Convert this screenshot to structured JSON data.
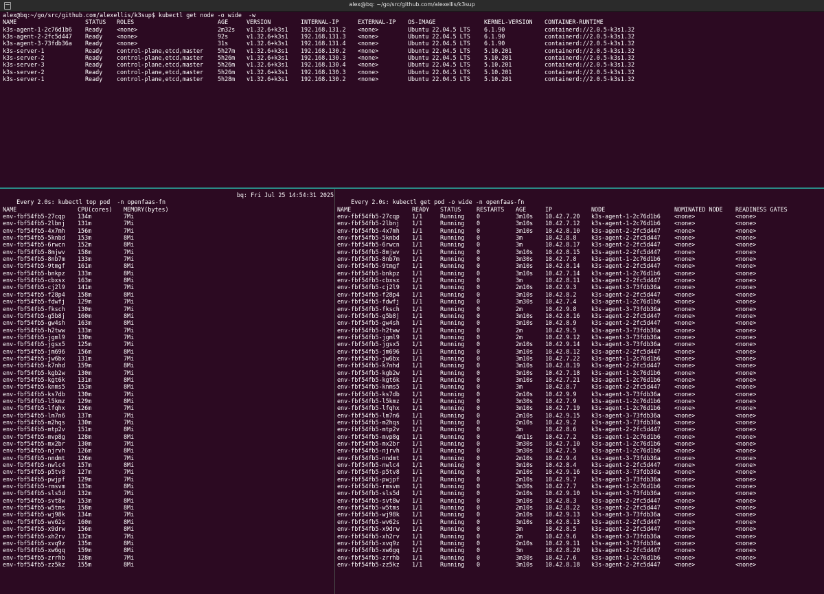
{
  "window": {
    "title": "alex@bq: ~/go/src/github.com/alexellis/k3sup"
  },
  "top_pane": {
    "prompt": "alex@bq:~/go/src/github.com/alexellis/k3sup$ kubectl get node -o wide  -w",
    "headers": [
      "NAME",
      "STATUS",
      "ROLES",
      "AGE",
      "VERSION",
      "INTERNAL-IP",
      "EXTERNAL-IP",
      "OS-IMAGE",
      "KERNEL-VERSION",
      "CONTAINER-RUNTIME"
    ],
    "rows": [
      [
        "k3s-agent-1-2c76d1b6",
        "Ready",
        "<none>",
        "2m32s",
        "v1.32.6+k3s1",
        "192.168.131.2",
        "<none>",
        "Ubuntu 22.04.5 LTS",
        "6.1.90",
        "containerd://2.0.5-k3s1.32"
      ],
      [
        "k3s-agent-2-2fc5d447",
        "Ready",
        "<none>",
        "92s",
        "v1.32.6+k3s1",
        "192.168.131.3",
        "<none>",
        "Ubuntu 22.04.5 LTS",
        "6.1.90",
        "containerd://2.0.5-k3s1.32"
      ],
      [
        "k3s-agent-3-73fdb36a",
        "Ready",
        "<none>",
        "31s",
        "v1.32.6+k3s1",
        "192.168.131.4",
        "<none>",
        "Ubuntu 22.04.5 LTS",
        "6.1.90",
        "containerd://2.0.5-k3s1.32"
      ],
      [
        "k3s-server-1",
        "Ready",
        "control-plane,etcd,master",
        "5h27m",
        "v1.32.6+k3s1",
        "192.168.130.2",
        "<none>",
        "Ubuntu 22.04.5 LTS",
        "5.10.201",
        "containerd://2.0.5-k3s1.32"
      ],
      [
        "k3s-server-2",
        "Ready",
        "control-plane,etcd,master",
        "5h26m",
        "v1.32.6+k3s1",
        "192.168.130.3",
        "<none>",
        "Ubuntu 22.04.5 LTS",
        "5.10.201",
        "containerd://2.0.5-k3s1.32"
      ],
      [
        "k3s-server-3",
        "Ready",
        "control-plane,etcd,master",
        "5h26m",
        "v1.32.6+k3s1",
        "192.168.130.4",
        "<none>",
        "Ubuntu 22.04.5 LTS",
        "5.10.201",
        "containerd://2.0.5-k3s1.32"
      ],
      [
        "k3s-server-2",
        "Ready",
        "control-plane,etcd,master",
        "5h26m",
        "v1.32.6+k3s1",
        "192.168.130.3",
        "<none>",
        "Ubuntu 22.04.5 LTS",
        "5.10.201",
        "containerd://2.0.5-k3s1.32"
      ],
      [
        "k3s-server-1",
        "Ready",
        "control-plane,etcd,master",
        "5h28m",
        "v1.32.6+k3s1",
        "192.168.130.2",
        "<none>",
        "Ubuntu 22.04.5 LTS",
        "5.10.201",
        "containerd://2.0.5-k3s1.32"
      ]
    ]
  },
  "bottom_left": {
    "watch_header": "Every 2.0s: kubectl top pod  -n openfaas-fn",
    "watch_host": "bq: Fri Jul 25 14:54:31 2025",
    "headers": [
      "NAME",
      "CPU(cores)",
      "MEMORY(bytes)"
    ],
    "rows": [
      [
        "env-fbf54fb5-27cqp",
        "134m",
        "7Mi"
      ],
      [
        "env-fbf54fb5-2lbnj",
        "131m",
        "7Mi"
      ],
      [
        "env-fbf54fb5-4x7mh",
        "156m",
        "7Mi"
      ],
      [
        "env-fbf54fb5-5knbd",
        "153m",
        "8Mi"
      ],
      [
        "env-fbf54fb5-6rwcn",
        "152m",
        "8Mi"
      ],
      [
        "env-fbf54fb5-8mjwv",
        "158m",
        "7Mi"
      ],
      [
        "env-fbf54fb5-8nb7m",
        "133m",
        "7Mi"
      ],
      [
        "env-fbf54fb5-9tmgf",
        "161m",
        "8Mi"
      ],
      [
        "env-fbf54fb5-bnkpz",
        "133m",
        "8Mi"
      ],
      [
        "env-fbf54fb5-cbxsx",
        "163m",
        "8Mi"
      ],
      [
        "env-fbf54fb5-cj2l9",
        "141m",
        "7Mi"
      ],
      [
        "env-fbf54fb5-f28p4",
        "158m",
        "8Mi"
      ],
      [
        "env-fbf54fb5-fdwfj",
        "129m",
        "7Mi"
      ],
      [
        "env-fbf54fb5-fksch",
        "130m",
        "7Mi"
      ],
      [
        "env-fbf54fb5-g5b8j",
        "160m",
        "8Mi"
      ],
      [
        "env-fbf54fb5-gw4sh",
        "163m",
        "8Mi"
      ],
      [
        "env-fbf54fb5-h2tww",
        "133m",
        "7Mi"
      ],
      [
        "env-fbf54fb5-jgml9",
        "130m",
        "7Mi"
      ],
      [
        "env-fbf54fb5-jgsx5",
        "125m",
        "7Mi"
      ],
      [
        "env-fbf54fb5-jm696",
        "156m",
        "8Mi"
      ],
      [
        "env-fbf54fb5-jw6bx",
        "131m",
        "7Mi"
      ],
      [
        "env-fbf54fb5-k7nhd",
        "159m",
        "8Mi"
      ],
      [
        "env-fbf54fb5-kgb2w",
        "130m",
        "7Mi"
      ],
      [
        "env-fbf54fb5-kgt6k",
        "131m",
        "8Mi"
      ],
      [
        "env-fbf54fb5-knms5",
        "153m",
        "8Mi"
      ],
      [
        "env-fbf54fb5-ks7db",
        "130m",
        "7Mi"
      ],
      [
        "env-fbf54fb5-l5kmz",
        "129m",
        "8Mi"
      ],
      [
        "env-fbf54fb5-lfqhx",
        "126m",
        "7Mi"
      ],
      [
        "env-fbf54fb5-lm7n6",
        "137m",
        "7Mi"
      ],
      [
        "env-fbf54fb5-m2hqs",
        "130m",
        "7Mi"
      ],
      [
        "env-fbf54fb5-mtp2v",
        "151m",
        "8Mi"
      ],
      [
        "env-fbf54fb5-mvp8g",
        "128m",
        "8Mi"
      ],
      [
        "env-fbf54fb5-mx2br",
        "130m",
        "7Mi"
      ],
      [
        "env-fbf54fb5-njrvh",
        "126m",
        "8Mi"
      ],
      [
        "env-fbf54fb5-nndmt",
        "126m",
        "7Mi"
      ],
      [
        "env-fbf54fb5-nwlc4",
        "157m",
        "8Mi"
      ],
      [
        "env-fbf54fb5-p5tv8",
        "127m",
        "7Mi"
      ],
      [
        "env-fbf54fb5-pwjpf",
        "129m",
        "7Mi"
      ],
      [
        "env-fbf54fb5-rmsvm",
        "133m",
        "8Mi"
      ],
      [
        "env-fbf54fb5-sls5d",
        "132m",
        "7Mi"
      ],
      [
        "env-fbf54fb5-svt8w",
        "153m",
        "8Mi"
      ],
      [
        "env-fbf54fb5-w5tms",
        "158m",
        "8Mi"
      ],
      [
        "env-fbf54fb5-wj98k",
        "134m",
        "7Mi"
      ],
      [
        "env-fbf54fb5-wv62s",
        "160m",
        "8Mi"
      ],
      [
        "env-fbf54fb5-x9drw",
        "156m",
        "8Mi"
      ],
      [
        "env-fbf54fb5-xh2rv",
        "132m",
        "7Mi"
      ],
      [
        "env-fbf54fb5-xvq9z",
        "135m",
        "8Mi"
      ],
      [
        "env-fbf54fb5-xw6gq",
        "159m",
        "8Mi"
      ],
      [
        "env-fbf54fb5-zrrhb",
        "128m",
        "7Mi"
      ],
      [
        "env-fbf54fb5-zz5kz",
        "155m",
        "8Mi"
      ]
    ]
  },
  "bottom_right": {
    "watch_header": "Every 2.0s: kubectl get pod -o wide -n openfaas-fn",
    "headers": [
      "NAME",
      "READY",
      "STATUS",
      "RESTARTS",
      "AGE",
      "IP",
      "NODE",
      "NOMINATED NODE",
      "READINESS GATES"
    ],
    "rows": [
      [
        "env-fbf54fb5-27cqp",
        "1/1",
        "Running",
        "0",
        "3m10s",
        "10.42.7.20",
        "k3s-agent-1-2c76d1b6",
        "<none>",
        "<none>"
      ],
      [
        "env-fbf54fb5-2lbnj",
        "1/1",
        "Running",
        "0",
        "3m10s",
        "10.42.7.12",
        "k3s-agent-1-2c76d1b6",
        "<none>",
        "<none>"
      ],
      [
        "env-fbf54fb5-4x7mh",
        "1/1",
        "Running",
        "0",
        "3m10s",
        "10.42.8.10",
        "k3s-agent-2-2fc5d447",
        "<none>",
        "<none>"
      ],
      [
        "env-fbf54fb5-5knbd",
        "1/1",
        "Running",
        "0",
        "3m",
        "10.42.8.8",
        "k3s-agent-2-2fc5d447",
        "<none>",
        "<none>"
      ],
      [
        "env-fbf54fb5-6rwcn",
        "1/1",
        "Running",
        "0",
        "3m",
        "10.42.8.17",
        "k3s-agent-2-2fc5d447",
        "<none>",
        "<none>"
      ],
      [
        "env-fbf54fb5-8mjwv",
        "1/1",
        "Running",
        "0",
        "3m10s",
        "10.42.8.15",
        "k3s-agent-2-2fc5d447",
        "<none>",
        "<none>"
      ],
      [
        "env-fbf54fb5-8nb7m",
        "1/1",
        "Running",
        "0",
        "3m30s",
        "10.42.7.8",
        "k3s-agent-1-2c76d1b6",
        "<none>",
        "<none>"
      ],
      [
        "env-fbf54fb5-9tmgf",
        "1/1",
        "Running",
        "0",
        "3m10s",
        "10.42.8.14",
        "k3s-agent-2-2fc5d447",
        "<none>",
        "<none>"
      ],
      [
        "env-fbf54fb5-bnkpz",
        "1/1",
        "Running",
        "0",
        "3m10s",
        "10.42.7.14",
        "k3s-agent-1-2c76d1b6",
        "<none>",
        "<none>"
      ],
      [
        "env-fbf54fb5-cbxsx",
        "1/1",
        "Running",
        "0",
        "3m",
        "10.42.8.11",
        "k3s-agent-2-2fc5d447",
        "<none>",
        "<none>"
      ],
      [
        "env-fbf54fb5-cj2l9",
        "1/1",
        "Running",
        "0",
        "2m10s",
        "10.42.9.3",
        "k3s-agent-3-73fdb36a",
        "<none>",
        "<none>"
      ],
      [
        "env-fbf54fb5-f28p4",
        "1/1",
        "Running",
        "0",
        "3m10s",
        "10.42.8.2",
        "k3s-agent-2-2fc5d447",
        "<none>",
        "<none>"
      ],
      [
        "env-fbf54fb5-fdwfj",
        "1/1",
        "Running",
        "0",
        "3m30s",
        "10.42.7.4",
        "k3s-agent-1-2c76d1b6",
        "<none>",
        "<none>"
      ],
      [
        "env-fbf54fb5-fksch",
        "1/1",
        "Running",
        "0",
        "2m",
        "10.42.9.8",
        "k3s-agent-3-73fdb36a",
        "<none>",
        "<none>"
      ],
      [
        "env-fbf54fb5-g5b8j",
        "1/1",
        "Running",
        "0",
        "3m10s",
        "10.42.8.16",
        "k3s-agent-2-2fc5d447",
        "<none>",
        "<none>"
      ],
      [
        "env-fbf54fb5-gw4sh",
        "1/1",
        "Running",
        "0",
        "3m10s",
        "10.42.8.9",
        "k3s-agent-2-2fc5d447",
        "<none>",
        "<none>"
      ],
      [
        "env-fbf54fb5-h2tww",
        "1/1",
        "Running",
        "0",
        "2m",
        "10.42.9.5",
        "k3s-agent-3-73fdb36a",
        "<none>",
        "<none>"
      ],
      [
        "env-fbf54fb5-jgml9",
        "1/1",
        "Running",
        "0",
        "2m",
        "10.42.9.12",
        "k3s-agent-3-73fdb36a",
        "<none>",
        "<none>"
      ],
      [
        "env-fbf54fb5-jgsx5",
        "1/1",
        "Running",
        "0",
        "2m10s",
        "10.42.9.14",
        "k3s-agent-3-73fdb36a",
        "<none>",
        "<none>"
      ],
      [
        "env-fbf54fb5-jm696",
        "1/1",
        "Running",
        "0",
        "3m10s",
        "10.42.8.12",
        "k3s-agent-2-2fc5d447",
        "<none>",
        "<none>"
      ],
      [
        "env-fbf54fb5-jw6bx",
        "1/1",
        "Running",
        "0",
        "3m10s",
        "10.42.7.22",
        "k3s-agent-1-2c76d1b6",
        "<none>",
        "<none>"
      ],
      [
        "env-fbf54fb5-k7nhd",
        "1/1",
        "Running",
        "0",
        "3m10s",
        "10.42.8.19",
        "k3s-agent-2-2fc5d447",
        "<none>",
        "<none>"
      ],
      [
        "env-fbf54fb5-kgb2w",
        "1/1",
        "Running",
        "0",
        "3m10s",
        "10.42.7.18",
        "k3s-agent-1-2c76d1b6",
        "<none>",
        "<none>"
      ],
      [
        "env-fbf54fb5-kgt6k",
        "1/1",
        "Running",
        "0",
        "3m10s",
        "10.42.7.21",
        "k3s-agent-1-2c76d1b6",
        "<none>",
        "<none>"
      ],
      [
        "env-fbf54fb5-knms5",
        "1/1",
        "Running",
        "0",
        "3m",
        "10.42.8.7",
        "k3s-agent-2-2fc5d447",
        "<none>",
        "<none>"
      ],
      [
        "env-fbf54fb5-ks7db",
        "1/1",
        "Running",
        "0",
        "2m10s",
        "10.42.9.9",
        "k3s-agent-3-73fdb36a",
        "<none>",
        "<none>"
      ],
      [
        "env-fbf54fb5-l5kmz",
        "1/1",
        "Running",
        "0",
        "3m30s",
        "10.42.7.9",
        "k3s-agent-1-2c76d1b6",
        "<none>",
        "<none>"
      ],
      [
        "env-fbf54fb5-lfqhx",
        "1/1",
        "Running",
        "0",
        "3m10s",
        "10.42.7.19",
        "k3s-agent-1-2c76d1b6",
        "<none>",
        "<none>"
      ],
      [
        "env-fbf54fb5-lm7n6",
        "1/1",
        "Running",
        "0",
        "2m10s",
        "10.42.9.15",
        "k3s-agent-3-73fdb36a",
        "<none>",
        "<none>"
      ],
      [
        "env-fbf54fb5-m2hqs",
        "1/1",
        "Running",
        "0",
        "2m10s",
        "10.42.9.2",
        "k3s-agent-3-73fdb36a",
        "<none>",
        "<none>"
      ],
      [
        "env-fbf54fb5-mtp2v",
        "1/1",
        "Running",
        "0",
        "3m",
        "10.42.8.6",
        "k3s-agent-2-2fc5d447",
        "<none>",
        "<none>"
      ],
      [
        "env-fbf54fb5-mvp8g",
        "1/1",
        "Running",
        "0",
        "4m11s",
        "10.42.7.2",
        "k3s-agent-1-2c76d1b6",
        "<none>",
        "<none>"
      ],
      [
        "env-fbf54fb5-mx2br",
        "1/1",
        "Running",
        "0",
        "3m30s",
        "10.42.7.10",
        "k3s-agent-1-2c76d1b6",
        "<none>",
        "<none>"
      ],
      [
        "env-fbf54fb5-njrvh",
        "1/1",
        "Running",
        "0",
        "3m30s",
        "10.42.7.5",
        "k3s-agent-1-2c76d1b6",
        "<none>",
        "<none>"
      ],
      [
        "env-fbf54fb5-nndmt",
        "1/1",
        "Running",
        "0",
        "2m10s",
        "10.42.9.4",
        "k3s-agent-3-73fdb36a",
        "<none>",
        "<none>"
      ],
      [
        "env-fbf54fb5-nwlc4",
        "1/1",
        "Running",
        "0",
        "3m10s",
        "10.42.8.4",
        "k3s-agent-2-2fc5d447",
        "<none>",
        "<none>"
      ],
      [
        "env-fbf54fb5-p5tv8",
        "1/1",
        "Running",
        "0",
        "2m10s",
        "10.42.9.16",
        "k3s-agent-3-73fdb36a",
        "<none>",
        "<none>"
      ],
      [
        "env-fbf54fb5-pwjpf",
        "1/1",
        "Running",
        "0",
        "2m10s",
        "10.42.9.7",
        "k3s-agent-3-73fdb36a",
        "<none>",
        "<none>"
      ],
      [
        "env-fbf54fb5-rmsvm",
        "1/1",
        "Running",
        "0",
        "3m30s",
        "10.42.7.7",
        "k3s-agent-1-2c76d1b6",
        "<none>",
        "<none>"
      ],
      [
        "env-fbf54fb5-sls5d",
        "1/1",
        "Running",
        "0",
        "2m10s",
        "10.42.9.10",
        "k3s-agent-3-73fdb36a",
        "<none>",
        "<none>"
      ],
      [
        "env-fbf54fb5-svt8w",
        "1/1",
        "Running",
        "0",
        "3m10s",
        "10.42.8.3",
        "k3s-agent-2-2fc5d447",
        "<none>",
        "<none>"
      ],
      [
        "env-fbf54fb5-w5tms",
        "1/1",
        "Running",
        "0",
        "2m10s",
        "10.42.8.22",
        "k3s-agent-2-2fc5d447",
        "<none>",
        "<none>"
      ],
      [
        "env-fbf54fb5-wj98k",
        "1/1",
        "Running",
        "0",
        "2m10s",
        "10.42.9.13",
        "k3s-agent-3-73fdb36a",
        "<none>",
        "<none>"
      ],
      [
        "env-fbf54fb5-wv62s",
        "1/1",
        "Running",
        "0",
        "3m10s",
        "10.42.8.13",
        "k3s-agent-2-2fc5d447",
        "<none>",
        "<none>"
      ],
      [
        "env-fbf54fb5-x9drw",
        "1/1",
        "Running",
        "0",
        "3m",
        "10.42.8.5",
        "k3s-agent-2-2fc5d447",
        "<none>",
        "<none>"
      ],
      [
        "env-fbf54fb5-xh2rv",
        "1/1",
        "Running",
        "0",
        "2m",
        "10.42.9.6",
        "k3s-agent-3-73fdb36a",
        "<none>",
        "<none>"
      ],
      [
        "env-fbf54fb5-xvq9z",
        "1/1",
        "Running",
        "0",
        "2m10s",
        "10.42.9.11",
        "k3s-agent-3-73fdb36a",
        "<none>",
        "<none>"
      ],
      [
        "env-fbf54fb5-xw6gq",
        "1/1",
        "Running",
        "0",
        "3m",
        "10.42.8.20",
        "k3s-agent-2-2fc5d447",
        "<none>",
        "<none>"
      ],
      [
        "env-fbf54fb5-zrrhb",
        "1/1",
        "Running",
        "0",
        "3m30s",
        "10.42.7.6",
        "k3s-agent-1-2c76d1b6",
        "<none>",
        "<none>"
      ],
      [
        "env-fbf54fb5-zz5kz",
        "1/1",
        "Running",
        "0",
        "3m10s",
        "10.42.8.18",
        "k3s-agent-2-2fc5d447",
        "<none>",
        "<none>"
      ]
    ]
  }
}
